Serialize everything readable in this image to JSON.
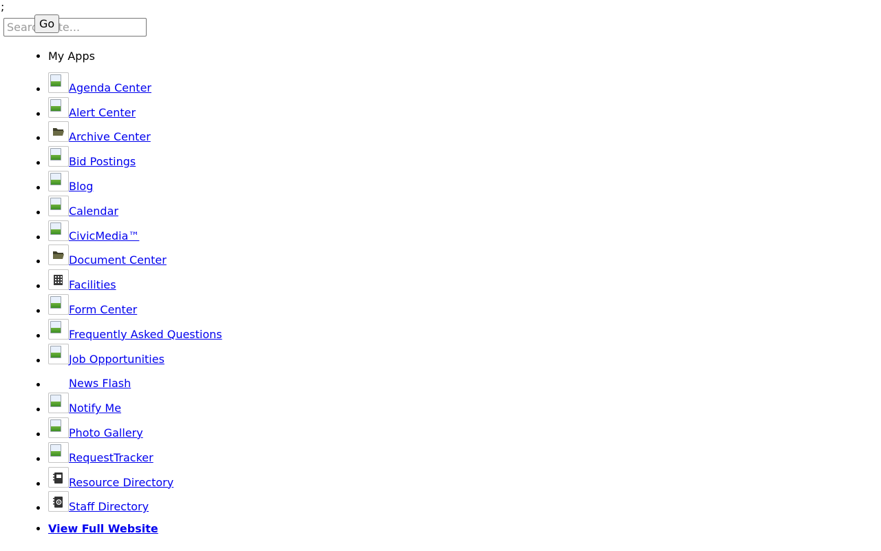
{
  "stray_text": ";",
  "search": {
    "placeholder": "Search Site...",
    "button_label": "Go"
  },
  "apps": {
    "heading": "My Apps",
    "items": [
      {
        "label": "Agenda Center",
        "icon": "broken-image-icon"
      },
      {
        "label": "Alert Center",
        "icon": "broken-image-icon"
      },
      {
        "label": "Archive Center",
        "icon": "folder-icon"
      },
      {
        "label": "Bid Postings",
        "icon": "broken-image-icon"
      },
      {
        "label": "Blog",
        "icon": "broken-image-icon"
      },
      {
        "label": "Calendar",
        "icon": "broken-image-icon"
      },
      {
        "label": "CivicMedia™",
        "icon": "broken-image-icon"
      },
      {
        "label": "Document Center",
        "icon": "folder-icon"
      },
      {
        "label": "Facilities",
        "icon": "building-icon"
      },
      {
        "label": "Form Center",
        "icon": "broken-image-icon"
      },
      {
        "label": "Frequently Asked Questions",
        "icon": "broken-image-icon"
      },
      {
        "label": "Job Opportunities",
        "icon": "broken-image-icon"
      },
      {
        "label": "News Flash",
        "icon": "blank-icon"
      },
      {
        "label": "Notify Me",
        "icon": "broken-image-icon"
      },
      {
        "label": "Photo Gallery",
        "icon": "broken-image-icon"
      },
      {
        "label": "RequestTracker",
        "icon": "broken-image-icon"
      },
      {
        "label": "Resource Directory",
        "icon": "notebook-icon"
      },
      {
        "label": "Staff Directory",
        "icon": "address-book-icon"
      }
    ]
  },
  "footer": {
    "full_website_label": "View Full Website"
  },
  "colors": {
    "link": "#0000ee",
    "folder": "#5a5a3c"
  }
}
